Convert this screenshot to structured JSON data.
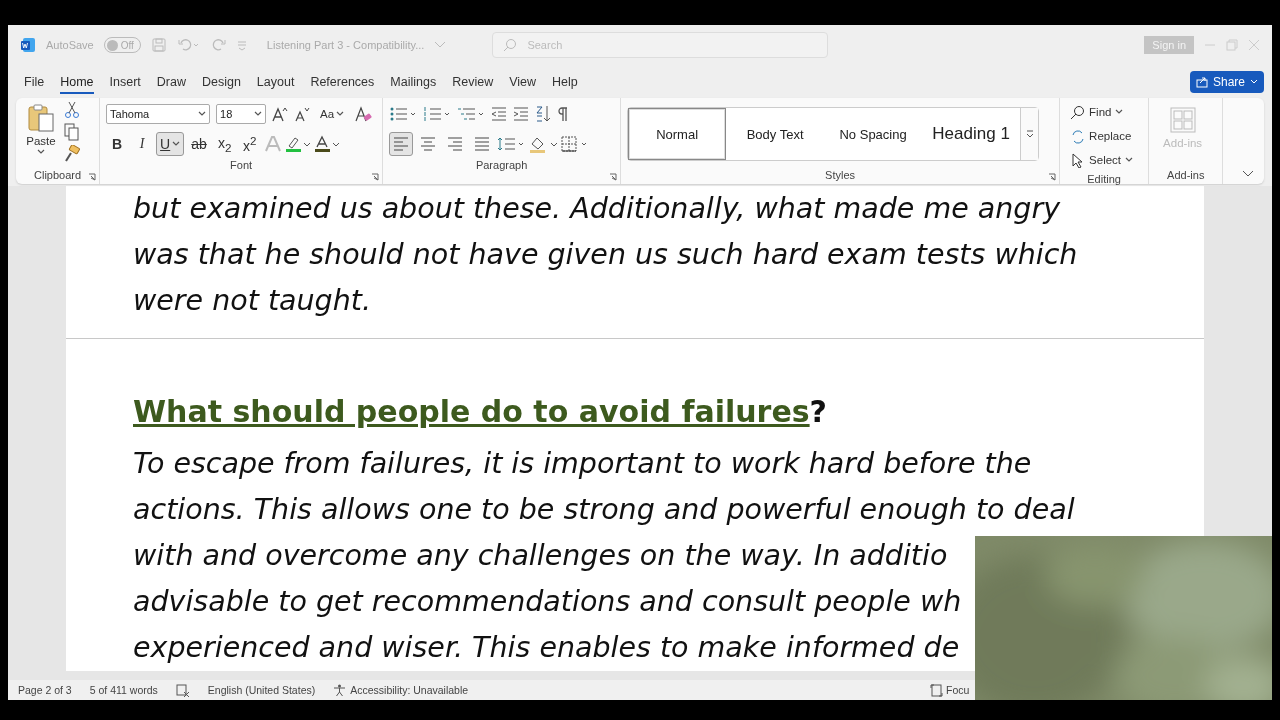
{
  "title_bar": {
    "autosave_label": "AutoSave",
    "autosave_on": false,
    "autosave_state": "Off",
    "document_title": "Listening Part 3  -  Compatibility...",
    "search": {
      "placeholder": "Search"
    },
    "sign_in": "Sign in"
  },
  "menu_tabs": [
    {
      "label": "File",
      "selected": false
    },
    {
      "label": "Home",
      "selected": true
    },
    {
      "label": "Insert",
      "selected": false
    },
    {
      "label": "Draw",
      "selected": false
    },
    {
      "label": "Design",
      "selected": false
    },
    {
      "label": "Layout",
      "selected": false
    },
    {
      "label": "References",
      "selected": false
    },
    {
      "label": "Mailings",
      "selected": false
    },
    {
      "label": "Review",
      "selected": false
    },
    {
      "label": "View",
      "selected": false
    },
    {
      "label": "Help",
      "selected": false
    }
  ],
  "share": "Share",
  "ribbon": {
    "clipboard": {
      "paste": "Paste",
      "label": "Clipboard"
    },
    "font": {
      "name": "Tahoma",
      "size": "18",
      "case_button": "Aa",
      "format_buttons": [
        {
          "kind": "bold",
          "label": "B",
          "selected": false
        },
        {
          "kind": "italic",
          "label": "I",
          "selected": false
        },
        {
          "kind": "underline",
          "label": "U",
          "selected": true
        },
        {
          "kind": "strike",
          "label": "ab",
          "selected": false
        },
        {
          "kind": "subscript",
          "label": "x$_{2}$",
          "selected": false
        },
        {
          "kind": "superscript",
          "label": "x$^{2}$",
          "selected": false
        }
      ],
      "label": "Font"
    },
    "paragraph": {
      "alignments": [
        {
          "kind": "left",
          "selected": true
        },
        {
          "kind": "center",
          "selected": false
        },
        {
          "kind": "right",
          "selected": false
        },
        {
          "kind": "justify",
          "selected": false
        }
      ],
      "label": "Paragraph"
    },
    "styles": {
      "items": [
        {
          "kind": "normal",
          "label": "Normal",
          "selected": true
        },
        {
          "kind": "normal",
          "label": "Body Text",
          "selected": false
        },
        {
          "kind": "normal",
          "label": "No Spacing",
          "selected": false
        },
        {
          "kind": "heading",
          "label": "Heading 1",
          "selected": false
        }
      ],
      "label": "Styles"
    },
    "editing": {
      "items": [
        {
          "kind": "find",
          "label": "Find"
        },
        {
          "kind": "replace",
          "label": "Replace"
        },
        {
          "kind": "select",
          "label": "Select"
        }
      ],
      "label": "Editing"
    },
    "addins": {
      "button": "Add-ins",
      "label": "Add-ins"
    }
  },
  "document": {
    "pages": [
      {
        "blocks": [
          {
            "kind": "paragraph",
            "lines": [
              "but examined us about these. Additionally, what made me angry",
              "was that he should not have given us such hard exam tests which",
              "were not taught."
            ]
          }
        ]
      },
      {
        "blocks": [
          {
            "kind": "heading",
            "text": "What should people do to avoid failures",
            "tail": "?"
          },
          {
            "kind": "paragraph",
            "lines": [
              "To escape from failures, it is important to work hard before the",
              "actions. This allows one to be strong and powerful enough to deal",
              "with and overcome any challenges on the way. In additio",
              "advisable to get recommendations and consult people wh",
              "experienced and wiser. This enables to make informed de"
            ]
          }
        ]
      }
    ]
  },
  "status_bar": {
    "page": "Page 2 of 3",
    "words": "5 of 411 words",
    "language": "English (United States)",
    "accessibility": "Accessibility: Unavailable",
    "focus": "Focu"
  }
}
